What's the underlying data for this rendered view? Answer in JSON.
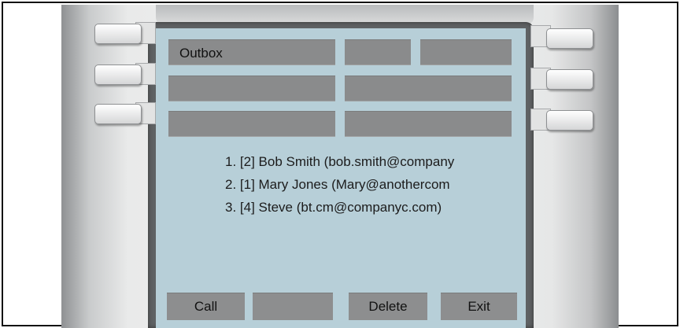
{
  "screen": {
    "title": "Outbox",
    "recipients": [
      "1. [2] Bob Smith (bob.smith@company",
      "2. [1] Mary Jones (Mary@anothercom",
      "3. [4] Steve (bt.cm@companyc.com)"
    ]
  },
  "softkeys": [
    "Call",
    "",
    "Delete",
    "Exit"
  ]
}
